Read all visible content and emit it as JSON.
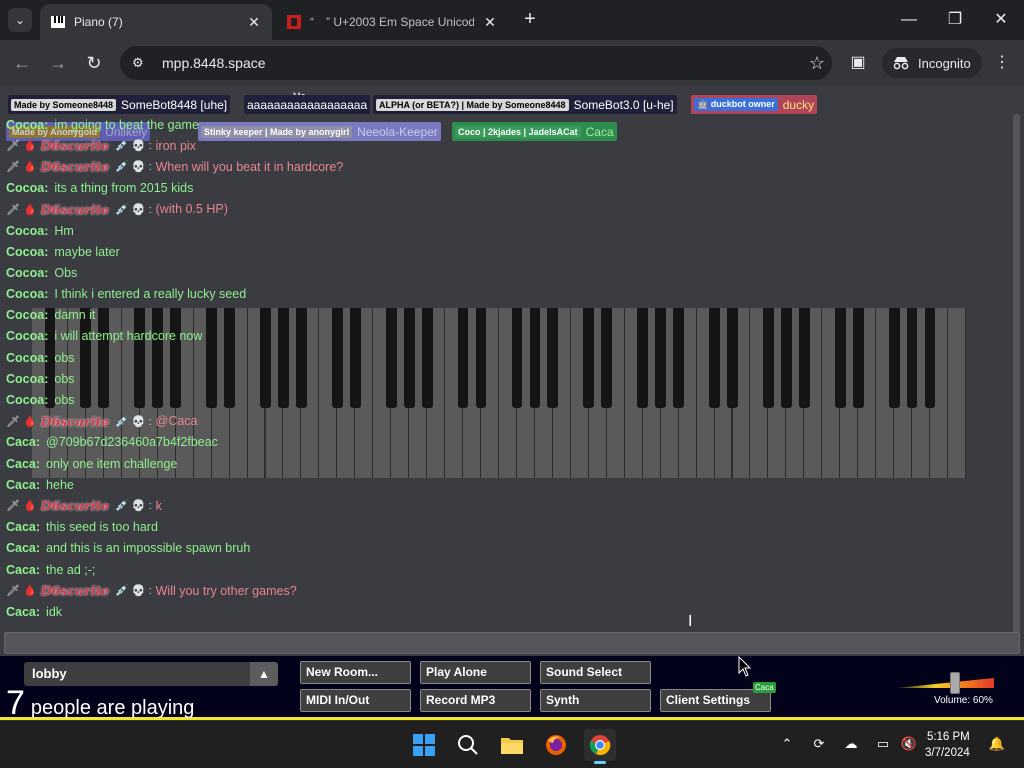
{
  "browser": {
    "tabs": [
      {
        "title": "Piano (7)",
        "active": true
      },
      {
        "title": "“ ” U+2003 Em Space Unicode",
        "active": false
      }
    ],
    "url": "mpp.8448.space",
    "profile_label": "Incognito"
  },
  "page": {
    "me_label": "Me",
    "users": [
      {
        "tag": "Made by Someone8448",
        "name": "SomeBot8448 [uhe]",
        "tag_bg": "#d8d8d8",
        "name_color": "#ffffff",
        "bg": "#20203a"
      },
      {
        "tag": "",
        "name": "aaaaaaaaaaaaaaaaaa",
        "tag_bg": "",
        "name_color": "#ffffff",
        "bg": "#20203a"
      },
      {
        "tag": "ALPHA (or BETA?) | Made by Someone8448",
        "name": "SomeBot3.0 [u-he]",
        "tag_bg": "#d8d8d8",
        "name_color": "#ffffff",
        "bg": "#20203a"
      },
      {
        "tag": "🤖 duckbot owner",
        "name": "ducky",
        "tag_bg": "#3a6fd8",
        "name_color": "#ffe27a",
        "bg": "#b04458"
      },
      {
        "tag": "Made by Anonygold",
        "name": "Unlikely",
        "tag_bg": "#a88a2a",
        "name_color": "#c9c9f5",
        "bg": "#6b6ad8"
      },
      {
        "tag": "Stinky keeper | Made by anonygirl",
        "name": "Neeola-Keeper",
        "tag_bg": "#9090a8",
        "name_color": "#c9c9f5",
        "bg": "#7a7abf"
      },
      {
        "tag": "Coco | 2kjades | JadelsACat",
        "name": "Caca",
        "tag_bg": "#3a9a5a",
        "name_color": "#9ff09f",
        "bg": "#2e8d4e"
      }
    ],
    "chat": [
      {
        "type": "cocoa",
        "who": "Cocoa:",
        "text": "im going to beat the game"
      },
      {
        "type": "d6",
        "who": "D6scurite",
        "text": "iron pix"
      },
      {
        "type": "d6",
        "who": "D6scurite",
        "text": "When will you beat it in hardcore?"
      },
      {
        "type": "cocoa",
        "who": "Cocoa:",
        "text": "its a thing from 2015 kids"
      },
      {
        "type": "d6",
        "who": "D6scurite",
        "text": "(with 0.5 HP)"
      },
      {
        "type": "cocoa",
        "who": "Cocoa:",
        "text": "Hm"
      },
      {
        "type": "cocoa",
        "who": "Cocoa:",
        "text": "maybe later"
      },
      {
        "type": "cocoa",
        "who": "Cocoa:",
        "text": "Obs"
      },
      {
        "type": "cocoa",
        "who": "Cocoa:",
        "text": "I think i entered a really lucky seed"
      },
      {
        "type": "cocoa",
        "who": "Cocoa:",
        "text": "damn it"
      },
      {
        "type": "cocoa",
        "who": "Cocoa:",
        "text": "i will attempt hardcore now"
      },
      {
        "type": "cocoa",
        "who": "Cocoa:",
        "text": "obs"
      },
      {
        "type": "cocoa",
        "who": "Cocoa:",
        "text": "obs"
      },
      {
        "type": "cocoa",
        "who": "Cocoa:",
        "text": "obs"
      },
      {
        "type": "d6",
        "who": "D6scurite",
        "text": "@Caca"
      },
      {
        "type": "caca",
        "who": "Caca:",
        "text": "@709b67d236460a7b4f2fbeac"
      },
      {
        "type": "caca",
        "who": "Caca:",
        "text": "only one item challenge"
      },
      {
        "type": "caca",
        "who": "Caca:",
        "text": "hehe"
      },
      {
        "type": "d6",
        "who": "D6scurite",
        "text": "k"
      },
      {
        "type": "caca",
        "who": "Caca:",
        "text": "this seed is too hard"
      },
      {
        "type": "caca",
        "who": "Caca:",
        "text": "and this is an impossible spawn bruh"
      },
      {
        "type": "caca",
        "who": "Caca:",
        "text": "the ad ;-;"
      },
      {
        "type": "d6",
        "who": "D6scurite",
        "text": "Will you try other games?"
      },
      {
        "type": "caca",
        "who": "Caca:",
        "text": "idk"
      }
    ],
    "room": "lobby",
    "player_count": "7",
    "playing_text": "people are playing",
    "buttons": {
      "new_room": "New Room...",
      "play_alone": "Play Alone",
      "sound_select": "Sound Select",
      "midi": "MIDI In/Out",
      "record": "Record MP3",
      "synth": "Synth",
      "client_settings": "Client Settings"
    },
    "caca_tag": "Caca",
    "volume_label": "Volume: 60%",
    "volume_level": 0.6
  },
  "taskbar": {
    "time": "5:16 PM",
    "date": "3/7/2024"
  },
  "colors": {
    "cocoa": "#8ff08f",
    "d6_name": "#d1384a",
    "d6_text": "#e8868c",
    "bottom_bar": "#02021a",
    "accent_yellow": "#f5e62a"
  }
}
